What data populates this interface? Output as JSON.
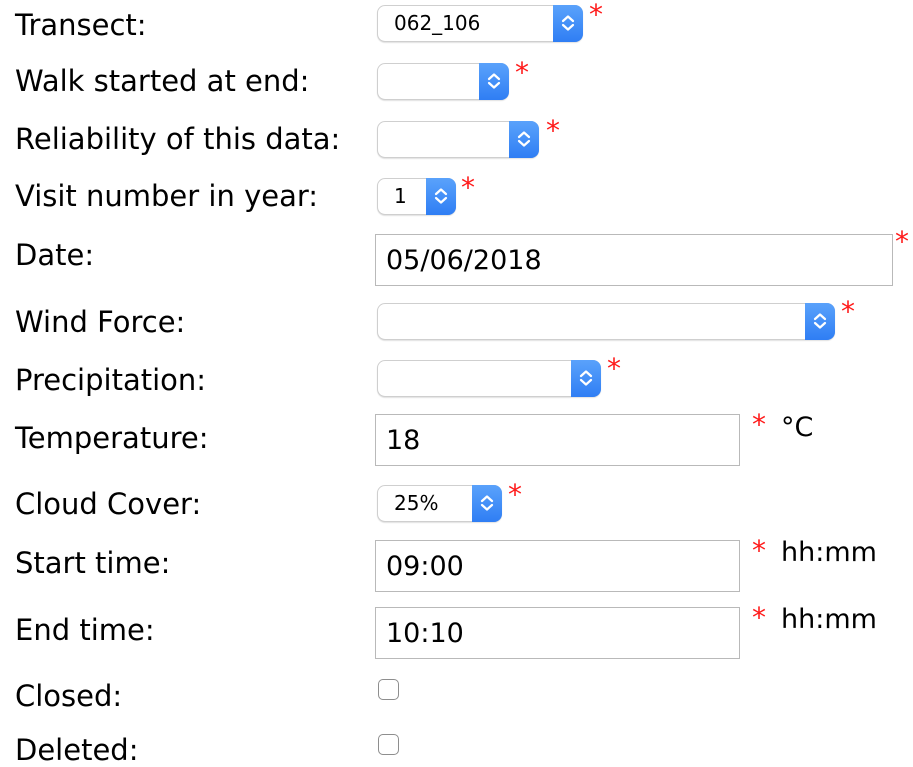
{
  "form": {
    "transect": {
      "label": "Transect:",
      "value": "062_106",
      "required_mark": "*"
    },
    "walk_started_at_end": {
      "label": "Walk started at end:",
      "value": "",
      "required_mark": "*"
    },
    "reliability": {
      "label": "Reliability of this data:",
      "value": "",
      "required_mark": "*"
    },
    "visit_number": {
      "label": "Visit number in year:",
      "value": "1",
      "required_mark": "*"
    },
    "date": {
      "label": "Date:",
      "value": "05/06/2018",
      "required_mark": "*"
    },
    "wind_force": {
      "label": "Wind Force:",
      "value": "",
      "required_mark": "*"
    },
    "precipitation": {
      "label": "Precipitation:",
      "value": "",
      "required_mark": "*"
    },
    "temperature": {
      "label": "Temperature:",
      "value": "18",
      "required_mark": "*",
      "unit": "°C"
    },
    "cloud_cover": {
      "label": "Cloud Cover:",
      "value": "25%",
      "required_mark": "*"
    },
    "start_time": {
      "label": "Start time:",
      "value": "09:00",
      "required_mark": "*",
      "unit": "hh:mm"
    },
    "end_time": {
      "label": "End time:",
      "value": "10:10",
      "required_mark": "*",
      "unit": "hh:mm"
    },
    "closed": {
      "label": "Closed:",
      "checked": false
    },
    "deleted": {
      "label": "Deleted:",
      "checked": false
    }
  },
  "colors": {
    "required_star": "#ff1a1a",
    "select_arrow": "#3a88f7"
  },
  "icons": {
    "select_arrow": "chevron-updown-icon"
  }
}
